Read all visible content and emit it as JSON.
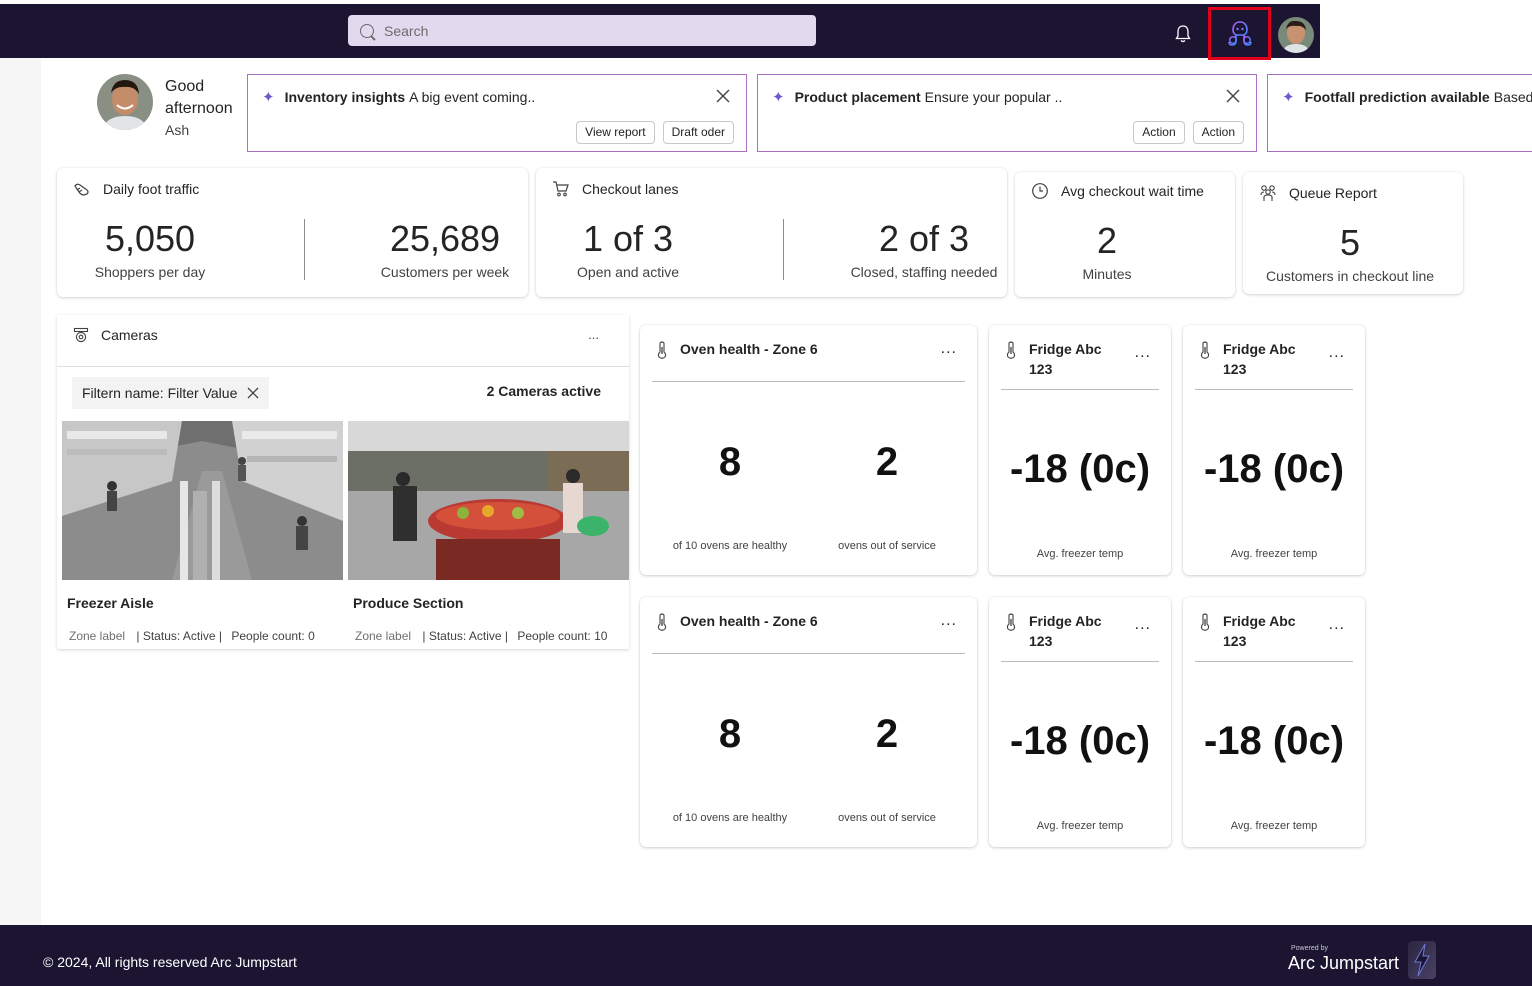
{
  "header": {
    "search_placeholder": "Search",
    "icons": {
      "search": "search-icon",
      "notifications": "bell-icon",
      "copilot": "copilot-icon",
      "profile": "avatar"
    },
    "colors": {
      "bar": "#1b1532",
      "search_bg": "#e3d9ef",
      "highlight": "#e0001a",
      "copilot": "#7b61ff"
    }
  },
  "greeting": {
    "line1": "Good",
    "line2": "afternoon",
    "name": "Ash"
  },
  "insights": [
    {
      "title": "Inventory insights",
      "text": "A big event coming..",
      "buttons": [
        "View report",
        "Draft oder"
      ]
    },
    {
      "title": "Product placement",
      "text": "Ensure your popular ..",
      "buttons": [
        "Action",
        "Action"
      ]
    },
    {
      "title": "Footfall prediction available",
      "text": "Based on"
    }
  ],
  "stats": {
    "foot_traffic": {
      "title": "Daily foot traffic",
      "left_value": "5,050",
      "left_label": "Shoppers per day",
      "right_value": "25,689",
      "right_label": "Customers per week"
    },
    "checkout_lanes": {
      "title": "Checkout lanes",
      "left_value": "1 of 3",
      "left_label": "Open and active",
      "right_value": "2 of 3",
      "right_label": "Closed, staffing needed"
    },
    "wait_time": {
      "title": "Avg checkout wait time",
      "value": "2",
      "label": "Minutes"
    },
    "queue": {
      "title": "Queue Report",
      "value": "5",
      "label": "Customers in checkout line"
    }
  },
  "cameras": {
    "title": "Cameras",
    "more": "...",
    "filter": "Filtern name: Filter Value",
    "active": "2 Cameras active",
    "feeds": [
      {
        "name": "Freezer Aisle",
        "zone": "Zone label",
        "status": "| Status: Active |",
        "people": "People count: 0"
      },
      {
        "name": "Produce Section",
        "zone": "Zone label",
        "status": "| Status: Active |",
        "people": "People count: 10"
      }
    ]
  },
  "tiles": {
    "oven1": {
      "title": "Oven health - Zone 6",
      "dots": "...",
      "left_value": "8",
      "left_label": "of 10 ovens are healthy",
      "right_value": "2",
      "right_label": "ovens out of service"
    },
    "fridge1": {
      "title_line1": "Fridge Abc",
      "title_line2": "123",
      "dots": "...",
      "value": "-18 (0c)",
      "label": "Avg. freezer temp"
    },
    "fridge2": {
      "title_line1": "Fridge Abc",
      "title_line2": "123",
      "dots": "...",
      "value": "-18 (0c)",
      "label": "Avg. freezer temp"
    },
    "oven2": {
      "title": "Oven health - Zone 6",
      "dots": "...",
      "left_value": "8",
      "left_label": "of 10 ovens are healthy",
      "right_value": "2",
      "right_label": "ovens out of service"
    },
    "fridge3": {
      "title_line1": "Fridge Abc",
      "title_line2": "123",
      "dots": "...",
      "value": "-18 (0c)",
      "label": "Avg. freezer temp"
    },
    "fridge4": {
      "title_line1": "Fridge Abc",
      "title_line2": "123",
      "dots": "...",
      "value": "-18 (0c)",
      "label": "Avg. freezer temp"
    }
  },
  "footer": {
    "copyright": "© 2024, All rights reserved Arc Jumpstart",
    "powered_by": "Powered by",
    "brand": "Arc Jumpstart"
  }
}
